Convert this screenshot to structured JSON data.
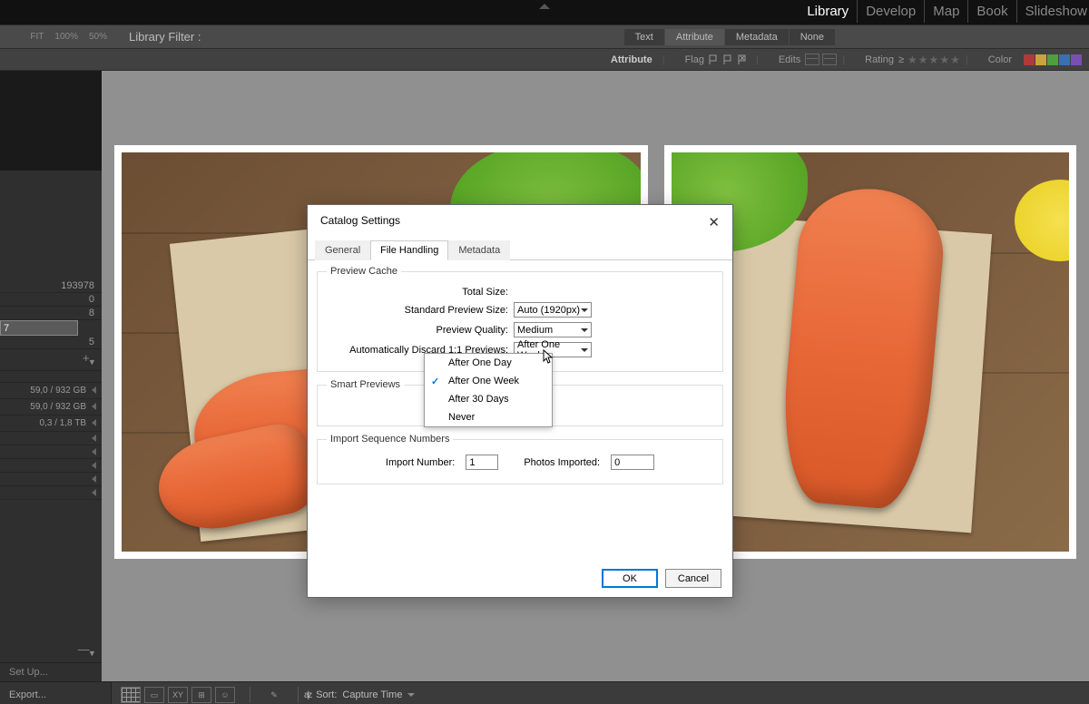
{
  "modules": {
    "library": "Library",
    "develop": "Develop",
    "map": "Map",
    "book": "Book",
    "slideshow": "Slideshow"
  },
  "zoom": {
    "fit": "FIT",
    "p100": "100%",
    "p50": "50%"
  },
  "filter": {
    "label": "Library Filter :",
    "tabs": {
      "text": "Text",
      "attribute": "Attribute",
      "metadata": "Metadata",
      "none": "None"
    }
  },
  "attr": {
    "attribute": "Attribute",
    "flag": "Flag",
    "edits": "Edits",
    "rating": "Rating",
    "gte": "≥",
    "color": "Color",
    "swatches": [
      "#b23939",
      "#c9a43a",
      "#4f9f3f",
      "#3a6fb2",
      "#7a4fb2"
    ]
  },
  "sidebar": {
    "counts": [
      "193978",
      "0",
      "8",
      "7",
      "5"
    ],
    "stats": [
      "59,0 / 932 GB",
      "59,0 / 932 GB",
      "0,3 / 1,8 TB"
    ],
    "setup": "Set Up..."
  },
  "dialog": {
    "title": "Catalog Settings",
    "tabs": {
      "general": "General",
      "file_handling": "File Handling",
      "metadata": "Metadata"
    },
    "preview_cache": "Preview Cache",
    "total_size_label": "Total Size:",
    "total_size_value": "",
    "std_preview_label": "Standard Preview Size:",
    "std_preview_value": "Auto (1920px)",
    "quality_label": "Preview Quality:",
    "quality_value": "Medium",
    "discard_label": "Automatically Discard 1:1 Previews:",
    "discard_value": "After One Week",
    "discard_options": [
      "After One Day",
      "After One Week",
      "After 30 Days",
      "Never"
    ],
    "smart_previews": "Smart Previews",
    "import_seq": "Import Sequence Numbers",
    "import_num_label": "Import Number:",
    "import_num_value": "1",
    "photos_imported_label": "Photos Imported:",
    "photos_imported_value": "0",
    "ok": "OK",
    "cancel": "Cancel"
  },
  "bottom": {
    "export": "Export...",
    "sort_label": "Sort:",
    "sort_value": "Capture Time"
  }
}
